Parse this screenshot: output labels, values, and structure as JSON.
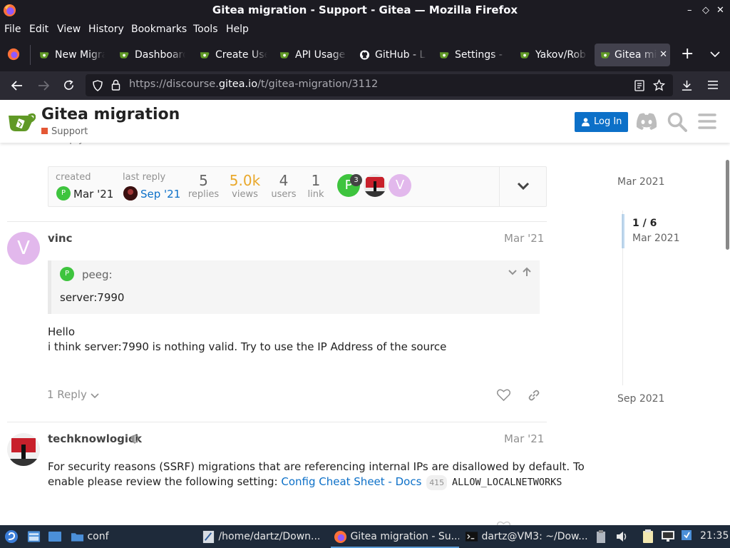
{
  "window": {
    "title": "Gitea migration - Support - Gitea — Mozilla Firefox",
    "controls": [
      "–",
      "◇",
      "✕"
    ]
  },
  "menu": [
    "File",
    "Edit",
    "View",
    "History",
    "Bookmarks",
    "Tools",
    "Help"
  ],
  "tabs": [
    {
      "label": "New Migra",
      "icon": "gitea-icon"
    },
    {
      "label": "Dashboard",
      "icon": "gitea-icon"
    },
    {
      "label": "Create Use",
      "icon": "gitea-icon"
    },
    {
      "label": "API Usage",
      "icon": "gitea-icon"
    },
    {
      "label": "GitHub - L",
      "icon": "github-icon"
    },
    {
      "label": "Settings -",
      "icon": "gitea-icon"
    },
    {
      "label": "Yakov/Rob",
      "icon": "gitea-icon"
    },
    {
      "label": "Gitea mi",
      "icon": "gitea-icon",
      "active": true
    }
  ],
  "new_tab": "+",
  "url": {
    "prefix": "https://discourse.",
    "domain": "gitea.io",
    "path": "/t/gitea-migration/3112"
  },
  "header": {
    "title": "Gitea migration",
    "category": "Support",
    "category_color": "#e45735",
    "login_label": "Log In"
  },
  "summary": {
    "created_label": "created",
    "created_date": "Mar '21",
    "last_reply_label": "last reply",
    "last_reply_date": "Sep '21",
    "replies_num": "5",
    "replies_label": "replies",
    "views_num": "5.0k",
    "views_label": "views",
    "users_num": "4",
    "users_label": "users",
    "link_num": "1",
    "link_label": "link",
    "participant_badge": "3"
  },
  "partial_reply": "1 Reply",
  "posts": [
    {
      "author": "vinc",
      "date": "Mar '21",
      "avatar_letter": "V",
      "quote_author": "peeg:",
      "quote_text": "server:7990",
      "line1": "Hello",
      "line2": "i think server:7990 is nothing valid. Try to use the IP Address of the source",
      "reply_label": "1 Reply"
    },
    {
      "author": "techknowlogick",
      "date": "Mar '21",
      "text_a": "For security reasons (SSRF) migrations that are referencing internal IPs are disallowed by default. To",
      "text_b": "enable please review the following setting:",
      "link_text": "Config Cheat Sheet - Docs",
      "link_count": "415",
      "code_text": "ALLOW_LOCALNETWORKS"
    }
  ],
  "timeline": {
    "top_date": "Mar 2021",
    "position": "1 / 6",
    "position_date": "Mar 2021",
    "bottom_date": "Sep 2021"
  },
  "taskbar": {
    "items": [
      {
        "label": "conf"
      },
      {
        "label": "/home/dartz/Down..."
      },
      {
        "label": "Gitea migration - Su...",
        "active": true
      },
      {
        "label": "dartz@VM3: ~/Dow..."
      }
    ],
    "clock": "21:35"
  },
  "colors": {
    "accent": "#0c70c8",
    "views": "#e9a82b",
    "avatar_green": "#3ec43e",
    "avatar_purple": "#e2b8ec"
  }
}
